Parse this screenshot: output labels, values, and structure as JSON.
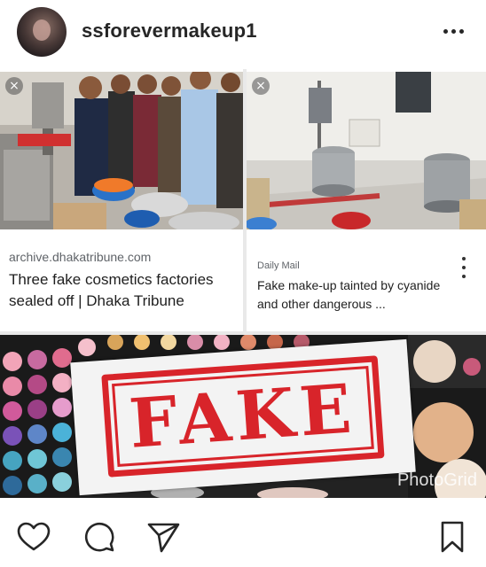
{
  "post": {
    "username": "ssforevermakeup1",
    "more_icon": "more-horizontal-icon"
  },
  "cards": [
    {
      "source": "archive.dhakatribune.com",
      "title": "Three fake cosmetics factories sealed off | Dhaka Tribune",
      "close": "×"
    },
    {
      "source": "Daily Mail",
      "title": "Fake make-up tainted by cyanide and other dangerous ...",
      "close": "×"
    }
  ],
  "collage": {
    "stamp_text": "FAKE",
    "watermark": "PhotoGrid"
  },
  "actions": {
    "like_icon": "heart-icon",
    "comment_icon": "comment-icon",
    "share_icon": "send-icon",
    "save_icon": "bookmark-icon"
  },
  "colors": {
    "stamp_red": "#d8242a",
    "text": "#262626",
    "link_gray": "#5f6368"
  }
}
